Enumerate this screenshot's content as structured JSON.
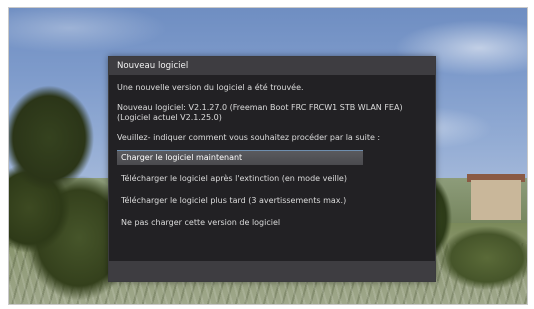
{
  "dialog": {
    "title": "Nouveau logiciel",
    "message_found": "Une nouvelle version du logiciel a été trouvée.",
    "new_software_line1": "Nouveau logiciel: V2.1.27.0 (Freeman Boot FRC FRCW1 STB WLAN FEA)",
    "new_software_line2": "(Logiciel actuel V2.1.25.0)",
    "prompt": "Veuillez- indiquer comment vous souhaitez procéder par la suite :",
    "options": [
      {
        "label": "Charger le logiciel maintenant",
        "selected": true
      },
      {
        "label": "Télécharger le logiciel après l'extinction (en mode veille)",
        "selected": false
      },
      {
        "label": "Télécharger le logiciel plus tard (3 avertissements max.)",
        "selected": false
      },
      {
        "label": "Ne pas charger cette version de logiciel",
        "selected": false
      }
    ]
  },
  "colors": {
    "dialog_bg": "#222124",
    "title_bar": "#3e3d41",
    "selection_bg": "#505054",
    "selection_accent": "#6f8fb0",
    "text": "#dcdcdc"
  }
}
